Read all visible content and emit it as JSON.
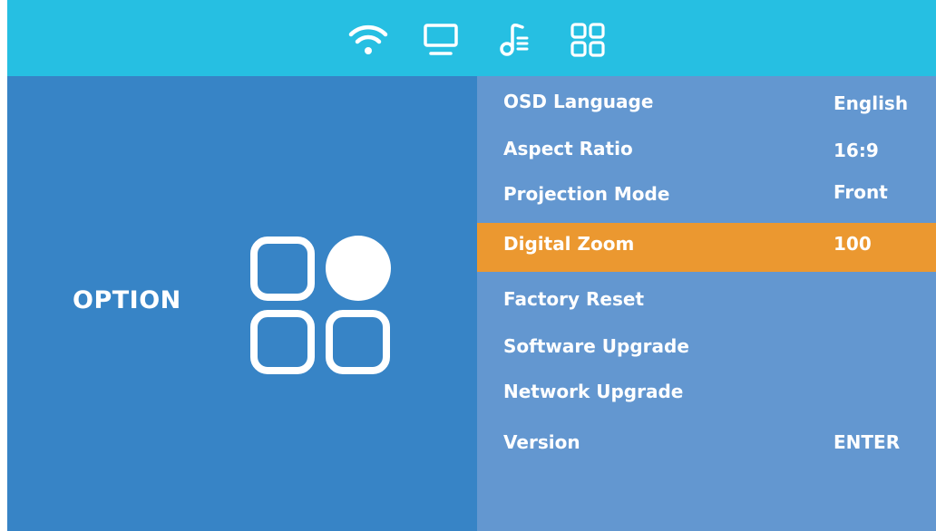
{
  "top_menu": {
    "tabs": [
      {
        "name": "network",
        "icon": "wifi-icon"
      },
      {
        "name": "display",
        "icon": "monitor-icon"
      },
      {
        "name": "audio",
        "icon": "music-note-icon"
      },
      {
        "name": "option",
        "icon": "grid-icon",
        "active": true
      }
    ]
  },
  "section": {
    "title": "OPTION",
    "icon": "option-grid-icon"
  },
  "menu": {
    "items": [
      {
        "label": "OSD Language",
        "value": "English"
      },
      {
        "label": "Aspect Ratio",
        "value": "16:9"
      },
      {
        "label": "Projection Mode",
        "value": "Front"
      },
      {
        "label": "Digital Zoom",
        "value": "100",
        "selected": true
      },
      {
        "label": "Factory Reset",
        "value": ""
      },
      {
        "label": "Software Upgrade",
        "value": ""
      },
      {
        "label": "Network Upgrade",
        "value": ""
      },
      {
        "label": "Version",
        "value": "ENTER"
      }
    ]
  },
  "colors": {
    "top_bar": "#26bfe2",
    "left_panel": "#3784c6",
    "right_panel": "#6397d0",
    "highlight": "#eb9830",
    "text": "#ffffff"
  }
}
